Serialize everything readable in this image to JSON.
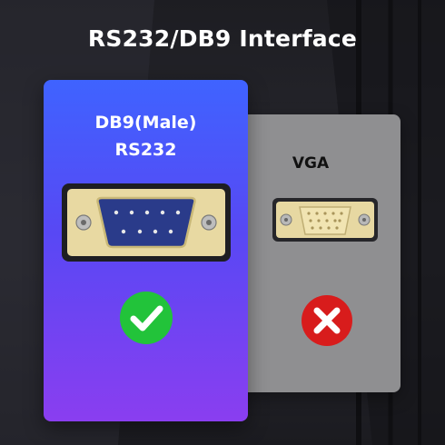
{
  "header": {
    "title": "RS232/DB9 Interface"
  },
  "left_card": {
    "line1": "DB9(Male)",
    "line2": "RS232",
    "status": "check",
    "status_color": "#22c33a",
    "accent_colors": [
      "#3f63ff",
      "#8a3ef0"
    ]
  },
  "right_card": {
    "label": "VGA",
    "status": "cross",
    "status_color": "#d81c1c",
    "card_color": "#8f8f91"
  }
}
